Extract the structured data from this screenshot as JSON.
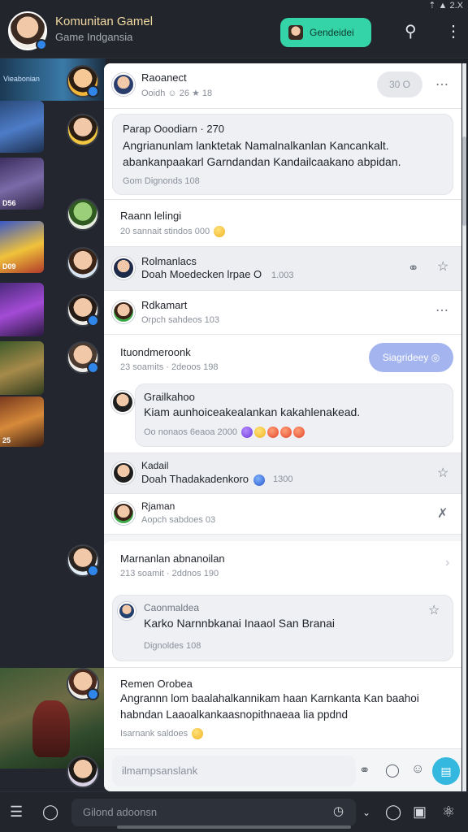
{
  "status_bar": {
    "icons": "⇡ ▲ 2.X"
  },
  "header": {
    "title": "Komunitan Gamel",
    "subtitle": "Game Indgansia",
    "join_label": "Gendeidei"
  },
  "left_strip": {
    "banner_caption": "Vieabonian",
    "art_captions": [
      "",
      "D56",
      "D09",
      "",
      "",
      "25"
    ]
  },
  "posts": [
    {
      "name": "Raoanect",
      "meta": "Ooidh ☺ 26 ★ 18",
      "pill": "30 O"
    },
    {
      "name": "Parap Ooodiarn · 270",
      "text": "Angrianunlam lanktetak Namalnalkanlan Kancankalt. abankanpaakarl Garndandan Kandailcaakano abpidan.",
      "meta": "Gom   Dignonds 108"
    },
    {
      "name": "Raann lelingi",
      "meta": "20 sannait stindos 000"
    },
    {
      "name": "Rolmanlacs",
      "text": "Doah Moedecken lrpae O",
      "meta": "1.003"
    },
    {
      "name": "Rdkamart",
      "meta": "Orpch sahdeos 103"
    },
    {
      "name": "Ituondmeroonk",
      "meta": "23 soamits · 2deoos 198",
      "pill": "Siagrideey ◎"
    },
    {
      "name": "Grailkahoo",
      "text": "Kiam aunhoiceakealankan kakahlenakead.",
      "meta": "Oo nonaos 6eaoa 2000"
    },
    {
      "name": "Kadail",
      "text": "Doah Thadakadenkoro",
      "meta": "1300"
    },
    {
      "name": "Rjaman",
      "meta": "Aopch sabdoes 03"
    },
    {
      "name": "Marnanlan abnanoilan",
      "meta": "213 soamit · 2ddnos 190"
    },
    {
      "name": "Caonmaldea",
      "text": "Karko Narnnbkanai Inaaol San Branai",
      "meta": "Dignoldes 108"
    },
    {
      "name": "Remen Orobea",
      "text": "Angrannn lom baalahalkannikam haan Karnkanta Kan baahoi habndan Laaoalkankaasnopithnaeaa lia ppdnd",
      "meta": "Isarnank saldoes"
    }
  ],
  "composer": {
    "placeholder": "ilmampsanslank"
  },
  "bottom_bar": {
    "search_placeholder": "Gilond adoonsn"
  },
  "colors": {
    "accent": "#35d3a8",
    "send": "#35b8e0",
    "pill_blue": "#a4b4ef"
  }
}
